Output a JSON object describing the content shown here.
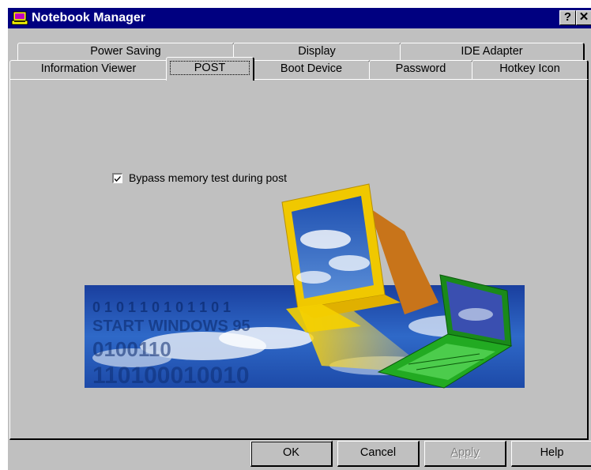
{
  "window": {
    "title": "Notebook Manager",
    "help_button": "?",
    "close_button": "✕"
  },
  "tabs": {
    "row1": [
      "Power Saving",
      "Display",
      "IDE Adapter"
    ],
    "row2": [
      "Information Viewer",
      "POST",
      "Boot Device",
      "Password",
      "Hotkey Icon"
    ],
    "active": "POST"
  },
  "post_panel": {
    "bypass_memory_test": {
      "label": "Bypass memory test during post",
      "checked": true
    }
  },
  "buttons": {
    "ok": "OK",
    "cancel": "Cancel",
    "apply": "Apply",
    "help": "Help"
  },
  "colors": {
    "titlebar": "#000080",
    "face": "#c0c0c0"
  }
}
